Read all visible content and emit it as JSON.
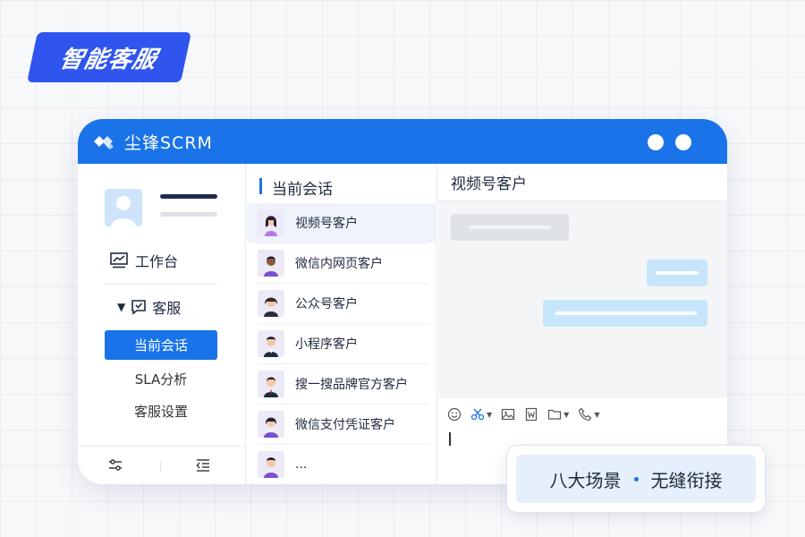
{
  "badge": {
    "label": "智能客服"
  },
  "window": {
    "brand": "尘锋SCRM",
    "accent": "#1a73e8"
  },
  "sidebar": {
    "workbench": "工作台",
    "customer_service": "客服",
    "sub_items": [
      "当前会话",
      "SLA分析",
      "客服设置"
    ],
    "active_sub": "当前会话"
  },
  "conversations": {
    "title": "当前会话",
    "items": [
      {
        "name": "视频号客户",
        "active": true
      },
      {
        "name": "微信内网页客户"
      },
      {
        "name": "公众号客户"
      },
      {
        "name": "小程序客户"
      },
      {
        "name": "搜一搜品牌官方客户"
      },
      {
        "name": "微信支付凭证客户"
      },
      {
        "name": "..."
      }
    ]
  },
  "chat": {
    "title": "视频号客户",
    "toolbar_icons": [
      "emoji-icon",
      "scissors-icon",
      "image-icon",
      "word-file-icon",
      "folder-icon",
      "phone-icon"
    ]
  },
  "tagline": {
    "left": "八大场景",
    "right": "无缝衔接"
  }
}
